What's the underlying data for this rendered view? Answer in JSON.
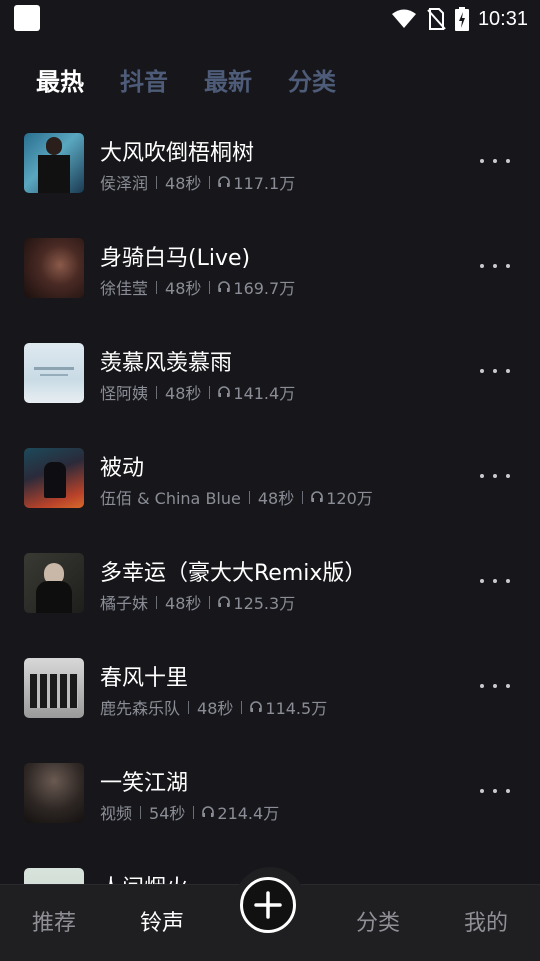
{
  "status_bar": {
    "time": "10:31"
  },
  "tabs": [
    {
      "label": "最热",
      "active": true
    },
    {
      "label": "抖音",
      "active": false
    },
    {
      "label": "最新",
      "active": false
    },
    {
      "label": "分类",
      "active": false
    }
  ],
  "songs": [
    {
      "title": "大风吹倒梧桐树",
      "artist": "侯泽润",
      "duration": "48秒",
      "plays": "117.1万"
    },
    {
      "title": "身骑白马(Live)",
      "artist": "徐佳莹",
      "duration": "48秒",
      "plays": "169.7万"
    },
    {
      "title": "羡慕风羡慕雨",
      "artist": "怪阿姨",
      "duration": "48秒",
      "plays": "141.4万"
    },
    {
      "title": "被动",
      "artist": "伍佰 & China Blue",
      "duration": "48秒",
      "plays": "120万"
    },
    {
      "title": "多幸运（豪大大Remix版）",
      "artist": "橘子妹",
      "duration": "48秒",
      "plays": "125.3万"
    },
    {
      "title": "春风十里",
      "artist": "鹿先森乐队",
      "duration": "48秒",
      "plays": "114.5万"
    },
    {
      "title": "一笑江湖",
      "artist": "视频",
      "duration": "54秒",
      "plays": "214.4万"
    },
    {
      "title": "人间烟火"
    }
  ],
  "bottom_nav": {
    "recommend": "推荐",
    "ringtone": "铃声",
    "category": "分类",
    "mine": "我的"
  },
  "colors": {
    "background": "#17171b",
    "tab_inactive": "#4e5c79",
    "meta_text": "#8a8d96"
  },
  "icons": [
    "app-icon",
    "wifi-icon",
    "no-sim-icon",
    "battery-icon",
    "headphone-icon",
    "more-icon",
    "plus-circle-icon"
  ]
}
